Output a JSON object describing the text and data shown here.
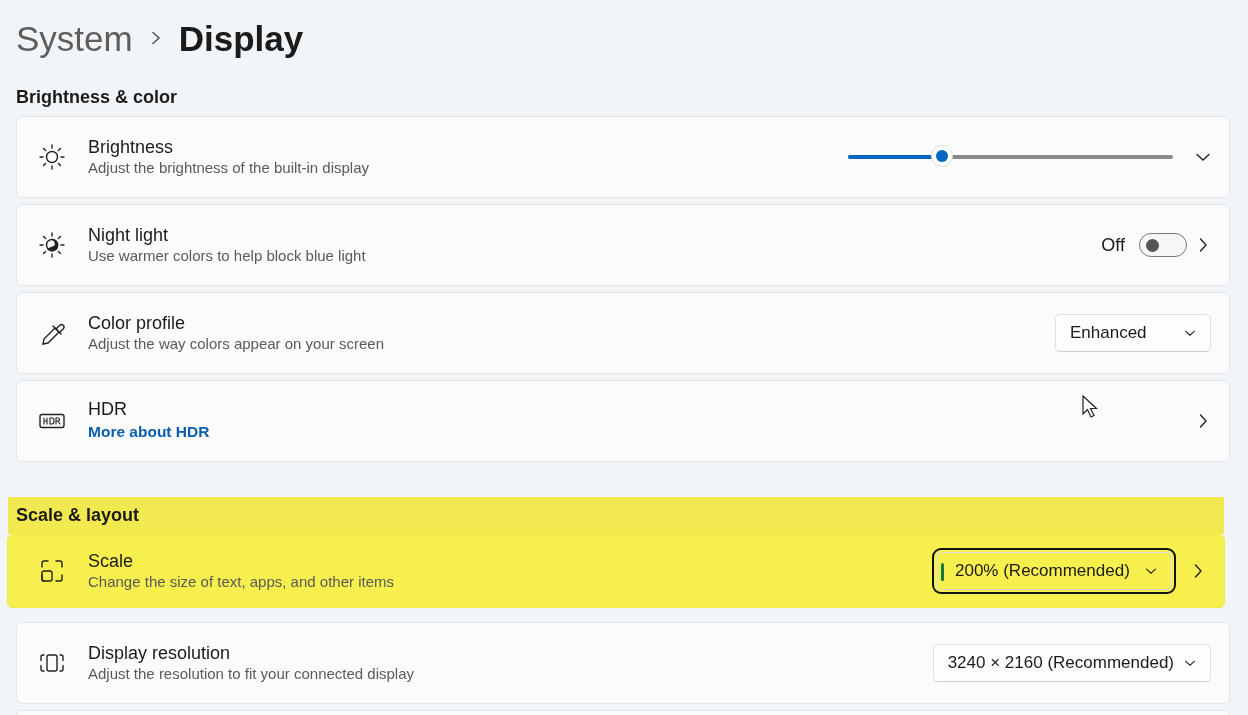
{
  "breadcrumb": [
    {
      "label": "System",
      "current": false
    },
    {
      "label": "Display",
      "current": true
    }
  ],
  "sections": [
    {
      "heading": "Brightness & color",
      "highlighted": false,
      "rows": [
        {
          "kind": "slider",
          "title": "Brightness",
          "subtitle": "Adjust the brightness of the built-in display",
          "level": 0.29,
          "expanded": false,
          "highlighted": false
        },
        {
          "kind": "toggle",
          "title": "Night light",
          "subtitle": "Use warmer colors to help block blue light",
          "state_text": "Off",
          "on": false,
          "highlighted": false
        },
        {
          "kind": "dropdown",
          "title": "Color profile",
          "subtitle": "Adjust the way colors appear on your screen",
          "value": "Enhanced",
          "focused": false,
          "chevron": false,
          "highlighted": false
        },
        {
          "kind": "link",
          "title": "HDR",
          "link": "More about HDR",
          "highlighted": false
        }
      ]
    },
    {
      "heading": "Scale & layout",
      "highlighted": true,
      "rows": [
        {
          "kind": "dropdown",
          "title": "Scale",
          "subtitle": "Change the size of text, apps, and other items",
          "value": "200% (Recommended)",
          "focused": true,
          "chevron": true,
          "highlighted": true
        },
        {
          "kind": "dropdown",
          "title": "Display resolution",
          "subtitle": "Adjust the resolution to fit your connected display",
          "value": "3240 × 2160 (Recommended)",
          "focused": false,
          "chevron": false,
          "highlighted": false
        }
      ]
    }
  ]
}
